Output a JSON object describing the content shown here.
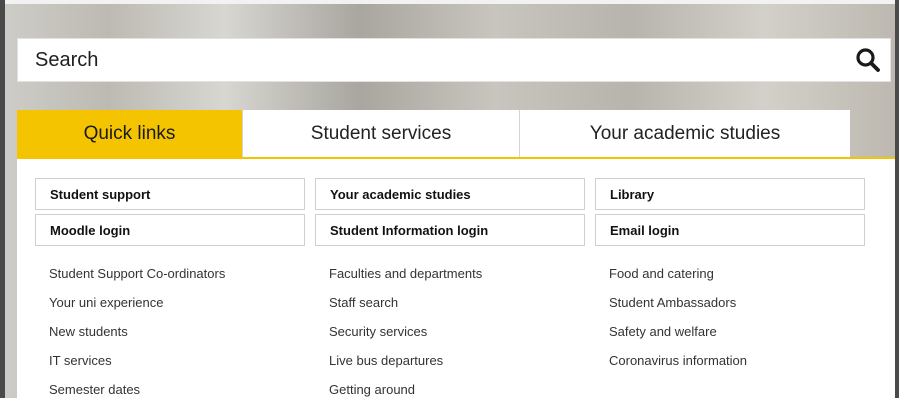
{
  "search": {
    "placeholder": "Search",
    "icon": "search-icon"
  },
  "tabs": [
    {
      "label": "Quick links",
      "active": true
    },
    {
      "label": "Student services",
      "active": false
    },
    {
      "label": "Your academic studies",
      "active": false
    }
  ],
  "quick_links": {
    "boxed": [
      [
        "Student support",
        "Your academic studies",
        "Library"
      ],
      [
        "Moodle login",
        "Student Information login",
        "Email login"
      ]
    ],
    "columns": [
      [
        "Student Support Co-ordinators",
        "Your uni experience",
        "New students",
        "IT services",
        "Semester dates"
      ],
      [
        "Faculties and departments",
        "Staff search",
        "Security services",
        "Live bus departures",
        "Getting around"
      ],
      [
        "Food and catering",
        "Student Ambassadors",
        "Safety and welfare",
        "Coronavirus information"
      ]
    ]
  },
  "colors": {
    "accent": "#f5c400",
    "text": "#1e1e1e",
    "panel_bg": "#ffffff"
  }
}
